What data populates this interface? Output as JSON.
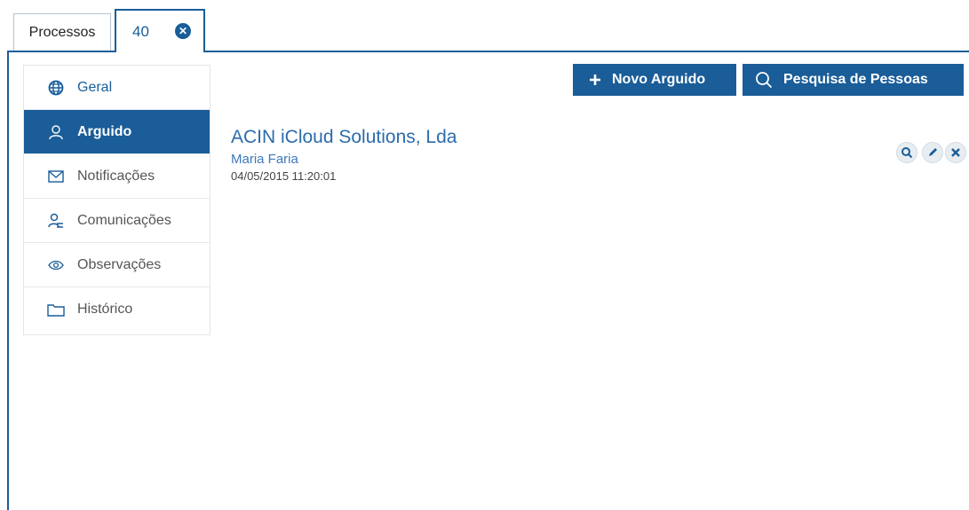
{
  "tabs": {
    "processos": "Processos",
    "current": "40"
  },
  "sidebar": {
    "items": [
      {
        "label": "Geral",
        "icon": "globe-icon"
      },
      {
        "label": "Arguido",
        "icon": "user-icon"
      },
      {
        "label": "Notificações",
        "icon": "mail-icon"
      },
      {
        "label": "Comunicações",
        "icon": "people-icon"
      },
      {
        "label": "Observações",
        "icon": "eye-icon"
      },
      {
        "label": "Histórico",
        "icon": "folder-icon"
      }
    ],
    "active_index": 1
  },
  "toolbar": {
    "novo_label": "Novo Arguido",
    "pesquisa_label": "Pesquisa de Pessoas"
  },
  "record": {
    "title": "ACIN iCloud Solutions, Lda",
    "person": "Maria Faria",
    "datetime": "04/05/2015 11:20:01"
  },
  "colors": {
    "primary": "#1a5d98",
    "link": "#2b6cab"
  }
}
